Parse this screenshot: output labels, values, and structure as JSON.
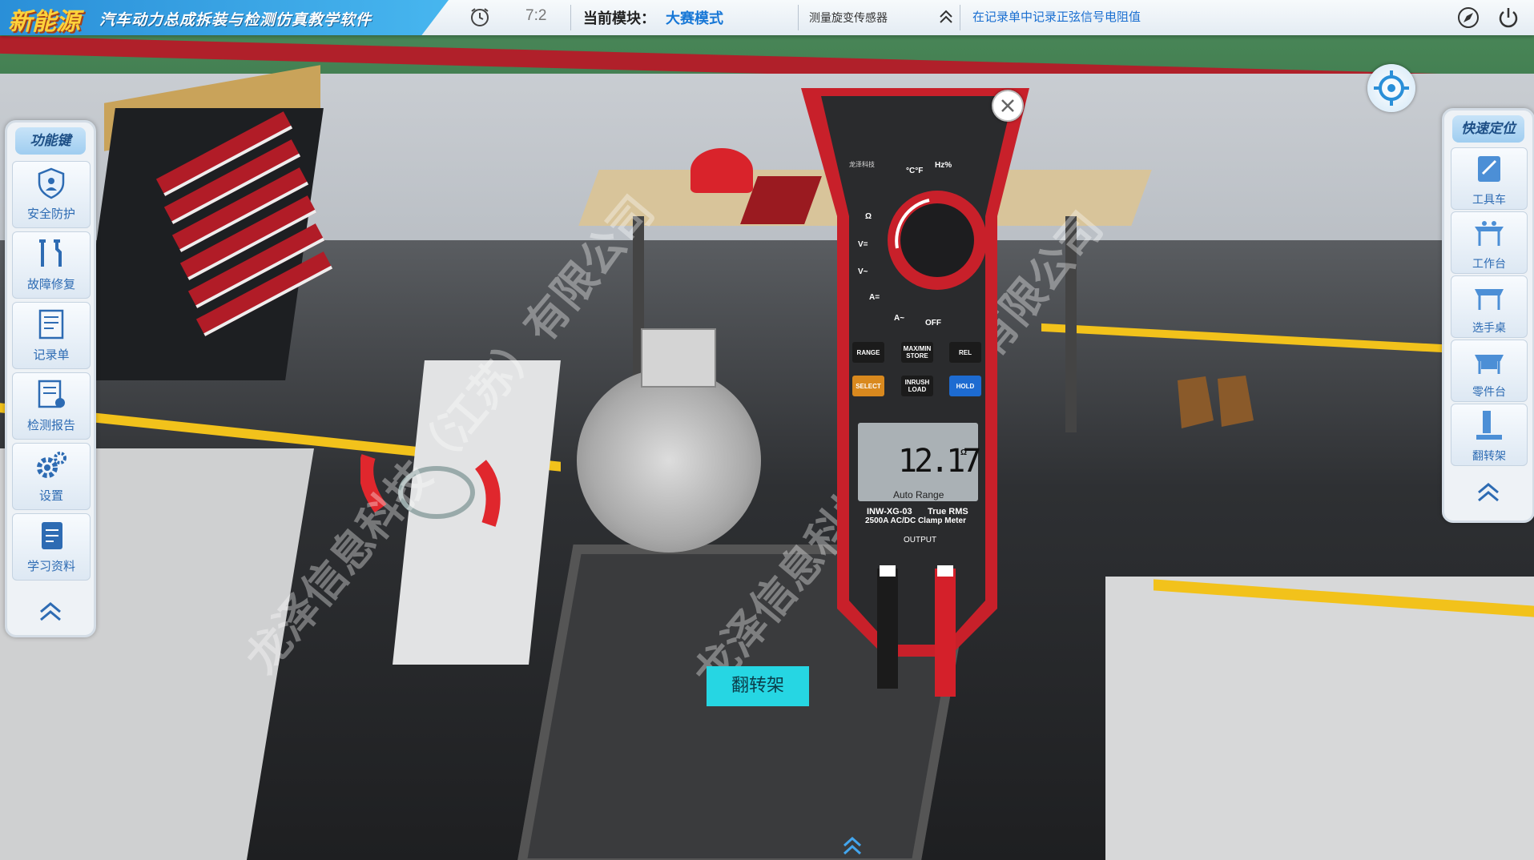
{
  "header": {
    "brand": "新能源",
    "title": "汽车动力总成拆装与检测仿真教学软件",
    "timer": "7:2",
    "module_label": "当前模块：",
    "module_value": "大赛模式",
    "step": "测量旋变传感器",
    "task": "在记录单中记录正弦信号电阻值"
  },
  "left_panel": {
    "title": "功能键",
    "items": [
      {
        "label": "安全防护",
        "icon": "shield-icon"
      },
      {
        "label": "故障修复",
        "icon": "wrench-icon"
      },
      {
        "label": "记录单",
        "icon": "record-sheet-icon"
      },
      {
        "label": "检测报告",
        "icon": "report-icon"
      },
      {
        "label": "设置",
        "icon": "gear-icon"
      },
      {
        "label": "学习资料",
        "icon": "book-icon"
      }
    ]
  },
  "right_panel": {
    "title": "快速定位",
    "items": [
      {
        "label": "工具车",
        "icon": "tool-cart-icon"
      },
      {
        "label": "工作台",
        "icon": "workbench-icon"
      },
      {
        "label": "选手桌",
        "icon": "player-desk-icon"
      },
      {
        "label": "零件台",
        "icon": "parts-table-icon"
      },
      {
        "label": "翻转架",
        "icon": "flip-stand-icon"
      }
    ]
  },
  "meter": {
    "display_value": "12.17",
    "display_unit": "Ω",
    "range_mode": "Auto Range",
    "model": "INW-XG-03",
    "model_desc": "True RMS",
    "model_desc2": "2500A AC/DC Clamp Meter",
    "output": "OUTPUT",
    "brand": "龙泽科技",
    "dial_labels": [
      "°C°F",
      "Hz%",
      "Ω",
      "V=",
      "V~",
      "A=",
      "A~",
      "OFF"
    ],
    "buttons": [
      "RANGE",
      "MAX/MIN STORE",
      "REL",
      "SELECT",
      "INRUSH LOAD",
      "HOLD"
    ]
  },
  "scene": {
    "flip_stand_label": "翻转架",
    "watermark": "龙泽信息科技（江苏）有限公司"
  },
  "colors": {
    "accent_blue": "#1777d6",
    "title_yellow": "#ffd23a",
    "meter_red": "#c8202a",
    "flip_label_bg": "#26d6e3"
  }
}
